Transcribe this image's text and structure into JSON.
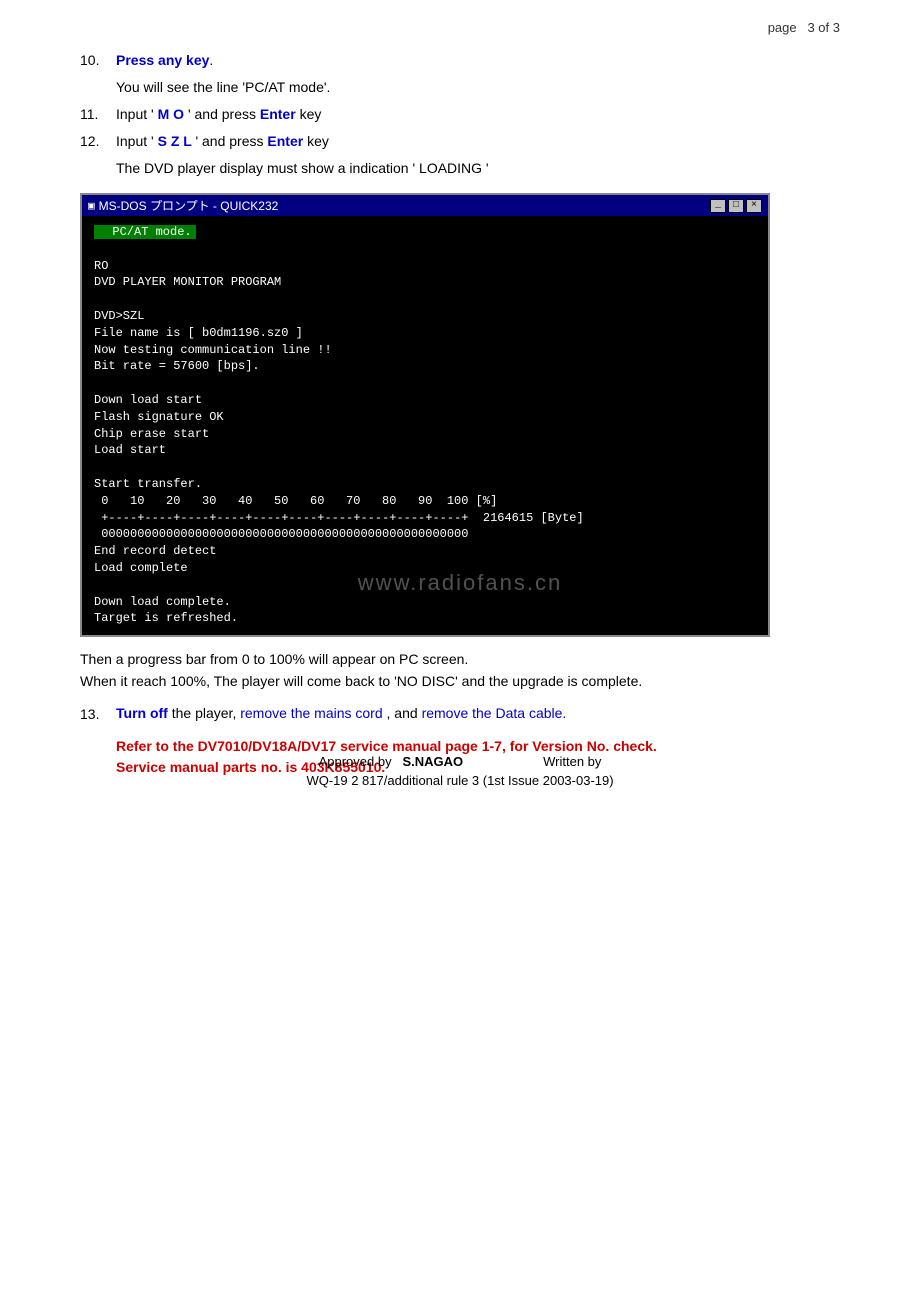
{
  "page": {
    "number_label": "page",
    "number_value": "3 of 3"
  },
  "steps": {
    "step10_number": "10.",
    "step10_prefix": "Press any key",
    "step10_prefix_text": ".",
    "step10_sub": "You will see the line 'PC/AT mode'.",
    "step11_number": "11.",
    "step11_text_before": "Input '",
    "step11_highlight": " M O ",
    "step11_text_after": "' and press",
    "step11_enter": "Enter",
    "step11_suffix": "key",
    "step12_number": "12.",
    "step12_text_before": "Input '",
    "step12_highlight": " S Z L ",
    "step12_text_after": "' and press",
    "step12_enter": "Enter",
    "step12_suffix": "key",
    "step12_sub": "The DVD player display must show a indication ' LOADING '",
    "step13_number": "13.",
    "step13_text1": "Turn off",
    "step13_text2": "the player,",
    "step13_text3": "remove the mains cord",
    "step13_text4": ", and",
    "step13_text5": "remove the Data cable."
  },
  "dos_window": {
    "titlebar": "MS-DOS プロンプト - QUICK232",
    "icon": "▣",
    "buttons": [
      "_",
      "□",
      "×"
    ],
    "pcmode_line": "  PC/AT mode.",
    "body_lines": [
      "",
      "RO",
      "DVD PLAYER MONITOR PROGRAM",
      "",
      "DVD>SZL",
      "File name is [ b0dm1196.sz0 ]",
      "Now testing communication line !!",
      "Bit rate = 57600 [bps].",
      "",
      "Down load start",
      "Flash signature OK",
      "Chip erase start",
      "Load start",
      "",
      "Start transfer.",
      " 0   10   20   30   40   50   60   70   80   90  100 [%]",
      " +----+----+----+----+----+----+----+----+----+----+  2164615 [Byte]",
      " 0000000000000000000000000000000000000000000000000",
      "End record detect",
      "Load complete",
      "",
      "Down load complete.",
      "Target is refreshed."
    ]
  },
  "progress_text": "Then a progress bar from 0 to 100% will appear on PC screen.",
  "reach_text": "When it reach 100%, The player will come back to 'NO DISC' and the upgrade is complete.",
  "note_line1": "Refer to the DV7010/DV18A/DV17 service manual page 1-7, for Version No. check.",
  "note_line2": "Service manual parts no. is 403K855010.",
  "watermark": "www.radiofans.cn",
  "footer": {
    "approved_label": "Approved by",
    "approved_name": "S.NAGAO",
    "written_label": "Written by",
    "doc_number": "WQ-19 2 817/additional rule 3 (1st   Issue   2003-03-19)"
  }
}
